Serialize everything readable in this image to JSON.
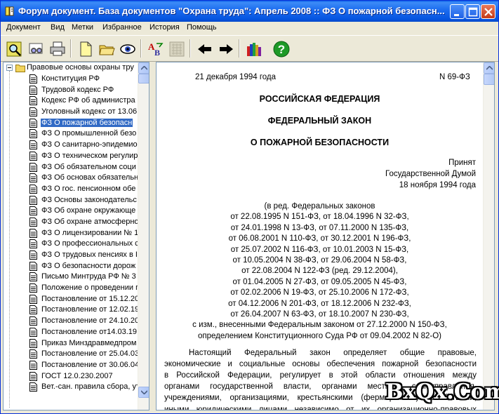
{
  "window": {
    "title": "Форум документ. База документов \"Охрана труда\": Апрель 2008 :: ФЗ О пожарной безопасн..."
  },
  "menu": [
    "Документ",
    "Вид",
    "Метки",
    "Избранное",
    "История",
    "Помощь"
  ],
  "toolbar": {
    "icons": [
      "search-icon",
      "binoculars-icon",
      "print-icon",
      "open-document-icon",
      "open-folder-icon",
      "view-eye-icon",
      "spellcheck-icon",
      "map-icon",
      "back-arrow-icon",
      "forward-arrow-icon",
      "library-books-icon",
      "help-icon"
    ]
  },
  "tree": {
    "root_label": "Правовые основы охраны тру",
    "items": [
      "Конституция РФ",
      "Трудовой кодекс РФ",
      "Кодекс РФ об администра",
      "Уголовный кодекс от 13.06",
      "ФЗ О пожарной безопасн",
      "ФЗ О промышленной безо",
      "ФЗ О санитарно-эпидемио",
      "ФЗ О техническом регулир",
      "ФЗ Об обязательном соци",
      "ФЗ Об основах обязательн",
      "ФЗ О гос. пенсионном обе",
      "ФЗ Основы законодательс",
      "ФЗ Об охране окружающе",
      "ФЗ Об охране атмосферно",
      "ФЗ О лицензировании № 1",
      "ФЗ О профессиональных с",
      "ФЗ О трудовых пенсиях в I",
      "ФЗ О безопасности дорож",
      "Письмо Минтруда РФ № 3",
      "Положение о проведении г",
      "Постановление от 15.12.20",
      "Постановление от 12.02.19",
      "Постановление от 24.10.20",
      "Постановление от14.03.19!",
      "Приказ Минздравмедпром",
      "Постановление от 25.04.03",
      "Постановление от 30.06.04",
      "ГОСТ 12.0.230.2007",
      "Вет.-сан. правила сбора, ут"
    ],
    "selected_index": 4
  },
  "document": {
    "date": "21 декабря 1994 года",
    "number": "N 69-ФЗ",
    "heading1": "РОССИЙСКАЯ ФЕДЕРАЦИЯ",
    "heading2": "ФЕДЕРАЛЬНЫЙ ЗАКОН",
    "heading3": "О ПОЖАРНОЙ БЕЗОПАСНОСТИ",
    "adopted": [
      "Принят",
      "Государственной Думой",
      "18 ноября 1994 года"
    ],
    "revisions": [
      "(в ред. Федеральных законов",
      "от 22.08.1995 N 151-ФЗ, от 18.04.1996 N 32-ФЗ,",
      "от 24.01.1998 N 13-ФЗ, от 07.11.2000 N 135-ФЗ,",
      "от 06.08.2001 N 110-ФЗ, от 30.12.2001 N 196-ФЗ,",
      "от 25.07.2002 N 116-ФЗ, от 10.01.2003 N 15-ФЗ,",
      "от 10.05.2004 N 38-ФЗ, от 29.06.2004 N 58-ФЗ,",
      "от 22.08.2004 N 122-ФЗ (ред. 29.12.2004),",
      "от 01.04.2005 N 27-ФЗ, от 09.05.2005 N 45-ФЗ,",
      "от 02.02.2006 N 19-ФЗ, от 25.10.2006 N 172-ФЗ,",
      "от 04.12.2006 N 201-ФЗ, от 18.12.2006 N 232-ФЗ,",
      "от 26.04.2007 N 63-ФЗ, от 18.10.2007 N 230-ФЗ,",
      "с изм., внесенными Федеральным законом от 27.12.2000 N 150-ФЗ,",
      "определением Конституционного Суда РФ от 09.04.2002 N 82-О)"
    ],
    "body": [
      "Настоящий Федеральный закон определяет общие правовые,",
      "экономические и социальные основы обеспечения пожарной безопасности",
      "в Российской Федерации, регулирует в этой области отношения между",
      "органами государственной власти, органами местного самоуправления,",
      "учреждениями, организациями, крестьянскими (фермерскими) хозяйствами,",
      "иными юридическими лицами независимо от их организационно-правовых"
    ]
  },
  "watermark": "BxQx.Com"
}
